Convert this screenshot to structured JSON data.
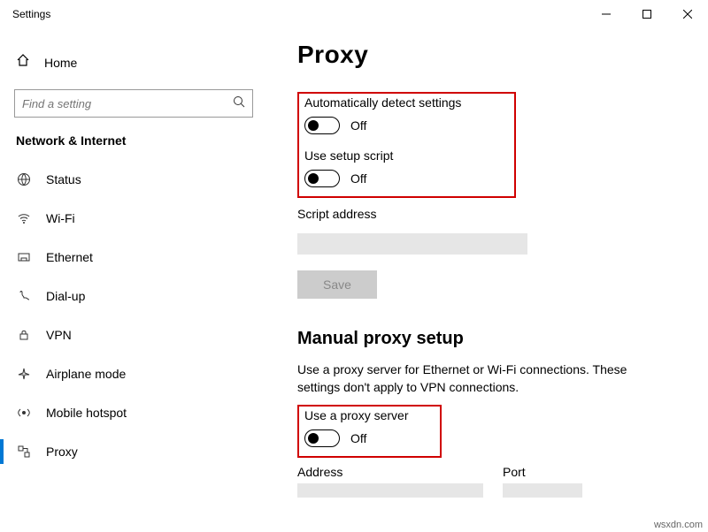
{
  "window": {
    "title": "Settings"
  },
  "sidebar": {
    "home": "Home",
    "search_placeholder": "Find a setting",
    "category": "Network & Internet",
    "items": [
      {
        "label": "Status"
      },
      {
        "label": "Wi-Fi"
      },
      {
        "label": "Ethernet"
      },
      {
        "label": "Dial-up"
      },
      {
        "label": "VPN"
      },
      {
        "label": "Airplane mode"
      },
      {
        "label": "Mobile hotspot"
      },
      {
        "label": "Proxy"
      }
    ]
  },
  "page": {
    "title": "Proxy",
    "auto_detect_label": "Automatically detect settings",
    "auto_detect_state": "Off",
    "setup_script_label": "Use setup script",
    "setup_script_state": "Off",
    "script_address_label": "Script address",
    "save_label": "Save",
    "manual_title": "Manual proxy setup",
    "manual_desc": "Use a proxy server for Ethernet or Wi-Fi connections. These settings don't apply to VPN connections.",
    "use_proxy_label": "Use a proxy server",
    "use_proxy_state": "Off",
    "address_label": "Address",
    "port_label": "Port"
  },
  "watermark": "wsxdn.com"
}
